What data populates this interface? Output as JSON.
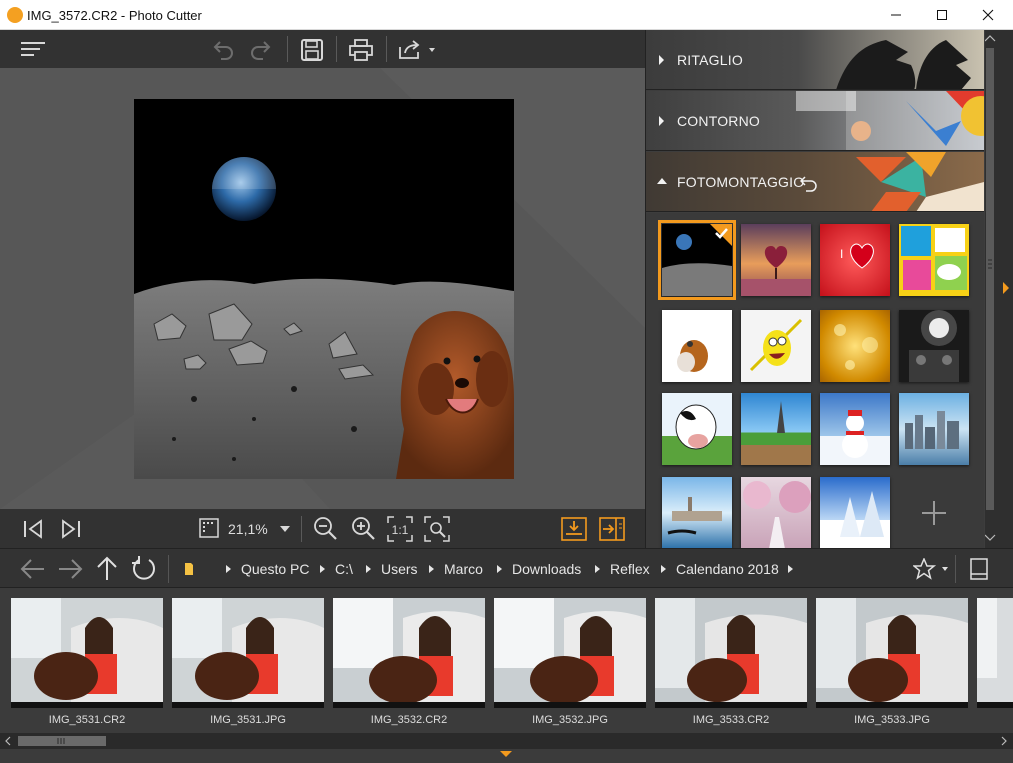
{
  "window": {
    "title": "IMG_3572.CR2 - Photo Cutter"
  },
  "icons": {
    "menu": "hamburger-icon",
    "undo": "undo-icon",
    "redo": "redo-icon",
    "save": "save-icon",
    "print": "print-icon",
    "share": "share-icon",
    "first": "first-image-icon",
    "last": "last-image-icon",
    "zoom_fit": "fit-icon",
    "zoom_out": "zoom-out-icon",
    "zoom_in": "zoom-in-icon",
    "actual": "actual-size-icon",
    "zoom_region": "zoom-region-icon",
    "export": "export-icon",
    "compare": "compare-icon",
    "back": "back-arrow-icon",
    "forward": "forward-arrow-icon",
    "up": "up-arrow-icon",
    "refresh": "refresh-icon",
    "folder": "folder-icon",
    "favorite": "star-icon",
    "panel": "panel-toggle-icon",
    "add": "plus-icon"
  },
  "zoom": {
    "value": "21,1%",
    "actual_label": "1:1"
  },
  "sidebar": {
    "sections": [
      {
        "label": "RITAGLIO",
        "expanded": false
      },
      {
        "label": "CONTORNO",
        "expanded": false
      },
      {
        "label": "FOTOMONTAGGIO",
        "expanded": true
      }
    ],
    "templates": [
      "moon",
      "heart-tree",
      "love-heart",
      "comic",
      "dog-cat",
      "smiley",
      "golden-bokeh",
      "camera-flashes",
      "cow",
      "eiffel-tower",
      "snowman",
      "city-skyline",
      "venice",
      "blossom-path",
      "snowy-trees"
    ]
  },
  "breadcrumb": [
    "Questo PC",
    "C:\\",
    "Users",
    "Marco",
    "Downloads",
    "Reflex",
    "Calendano 2018"
  ],
  "filmstrip": [
    {
      "name": "IMG_3531.CR2"
    },
    {
      "name": "IMG_3531.JPG"
    },
    {
      "name": "IMG_3532.CR2"
    },
    {
      "name": "IMG_3532.JPG"
    },
    {
      "name": "IMG_3533.CR2"
    },
    {
      "name": "IMG_3533.JPG"
    }
  ],
  "colors": {
    "accent": "#f39a1e",
    "panel": "#323232",
    "canvas": "#575757"
  }
}
